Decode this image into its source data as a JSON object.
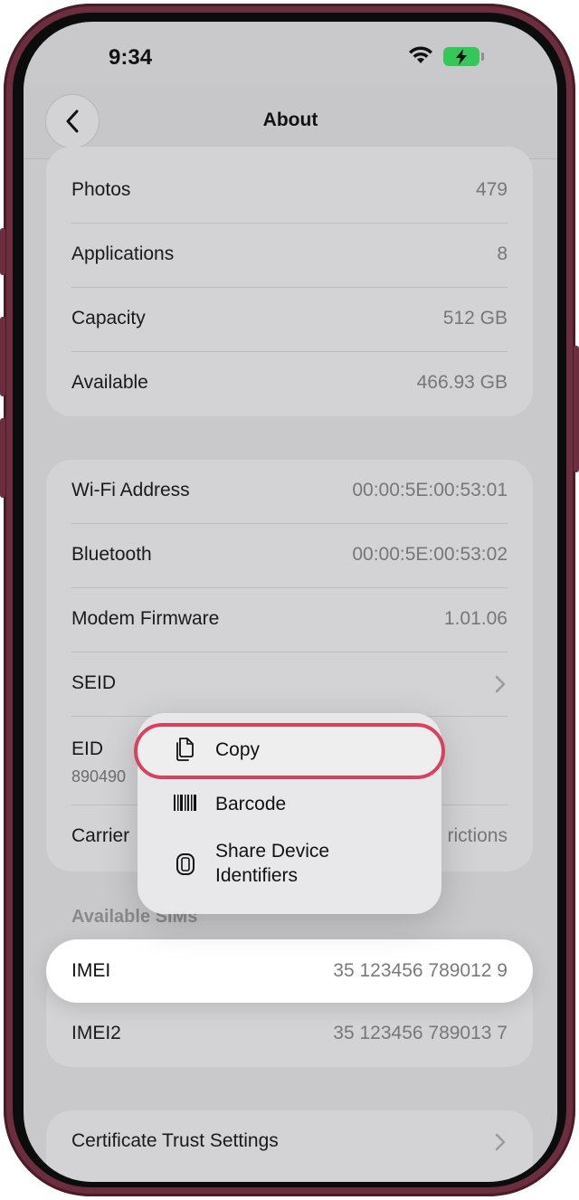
{
  "status_bar": {
    "time": "9:34"
  },
  "nav": {
    "title": "About"
  },
  "storage_rows": [
    {
      "label": "Photos",
      "value": "479"
    },
    {
      "label": "Applications",
      "value": "8"
    },
    {
      "label": "Capacity",
      "value": "512 GB"
    },
    {
      "label": "Available",
      "value": "466.93 GB"
    }
  ],
  "network_rows": [
    {
      "label": "Wi-Fi Address",
      "value": "00:00:5E:00:53:01"
    },
    {
      "label": "Bluetooth",
      "value": "00:00:5E:00:53:02"
    },
    {
      "label": "Modem Firmware",
      "value": "1.01.06"
    },
    {
      "label": "SEID",
      "value": ""
    },
    {
      "label": "EID",
      "sublabel": "890490",
      "value": ""
    },
    {
      "label": "Carrier",
      "value": "rictions"
    }
  ],
  "sims": {
    "header": "Available SIMs",
    "imei": {
      "label": "IMEI",
      "value": "35 123456 789012 9"
    },
    "imei2": {
      "label": "IMEI2",
      "value": "35 123456 789013 7"
    }
  },
  "certificate": {
    "label": "Certificate Trust Settings"
  },
  "context_menu": {
    "items": [
      {
        "label": "Copy",
        "icon": "copy-icon"
      },
      {
        "label": "Barcode",
        "icon": "barcode-icon"
      },
      {
        "label": "Share Device Identifiers",
        "label_line1": "Share Device",
        "label_line2": "Identifiers",
        "icon": "phone-icon"
      }
    ]
  },
  "colors": {
    "highlight": "#d8415f",
    "battery": "#35c759",
    "frame": "#6b2e3e"
  }
}
